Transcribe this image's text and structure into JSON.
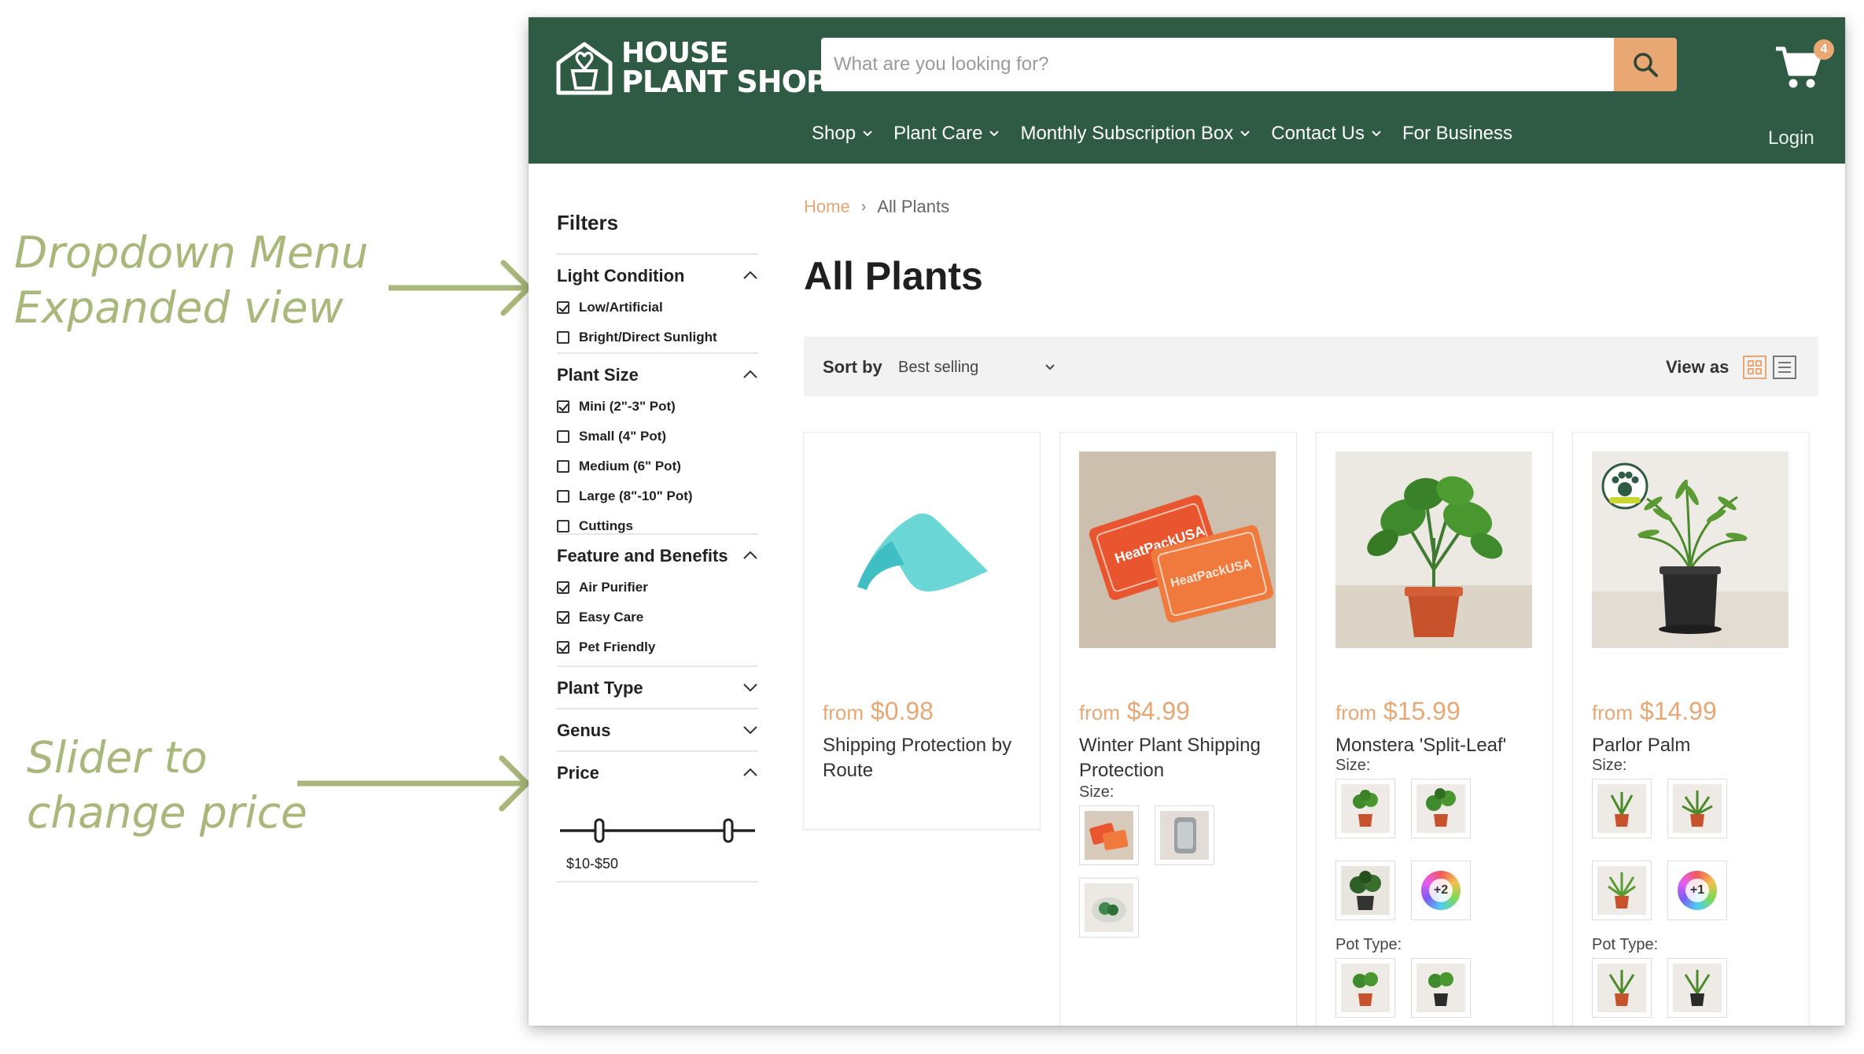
{
  "annotations": {
    "dropdown_line1": "Dropdown Menu",
    "dropdown_line2": "Expanded view",
    "slider_line1": "Slider to",
    "slider_line2": "change price"
  },
  "header": {
    "logo_line1": "HOUSE",
    "logo_line2": "PLANT SHOP",
    "search_placeholder": "What are you looking for?",
    "cart_count": "4",
    "login": "Login",
    "nav": [
      "Shop",
      "Plant Care",
      "Monthly Subscription Box",
      "Contact Us",
      "For Business"
    ]
  },
  "sidebar": {
    "title": "Filters",
    "sections": {
      "light": {
        "title": "Light Condition",
        "options": [
          {
            "label": "Low/Artificial",
            "checked": true
          },
          {
            "label": "Bright/Direct Sunlight",
            "checked": false
          }
        ]
      },
      "size": {
        "title": "Plant Size",
        "options": [
          {
            "label": "Mini (2\"-3\" Pot)",
            "checked": true
          },
          {
            "label": "Small (4\" Pot)",
            "checked": false
          },
          {
            "label": "Medium (6\" Pot)",
            "checked": false
          },
          {
            "label": "Large (8\"-10\" Pot)",
            "checked": false
          },
          {
            "label": "Cuttings",
            "checked": false
          }
        ]
      },
      "features": {
        "title": "Feature and Benefits",
        "options": [
          {
            "label": "Air Purifier",
            "checked": true
          },
          {
            "label": "Easy Care",
            "checked": true
          },
          {
            "label": "Pet Friendly",
            "checked": true
          }
        ]
      },
      "type": {
        "title": "Plant Type"
      },
      "genus": {
        "title": "Genus"
      },
      "price": {
        "title": "Price",
        "range": "$10-$50",
        "min": 10,
        "max": 50
      }
    }
  },
  "main": {
    "breadcrumb_home": "Home",
    "breadcrumb_current": "All Plants",
    "title": "All Plants",
    "sort_label": "Sort by",
    "sort_value": "Best selling",
    "view_label": "View as",
    "size_label": "Size:",
    "pot_type_label": "Pot Type:",
    "from": "from",
    "products": [
      {
        "price": "$0.98",
        "name": "Shipping Protection by Route"
      },
      {
        "price": "$4.99",
        "name": "Winter Plant Shipping Protection",
        "heatpack": "HeatPackUSA"
      },
      {
        "price": "$15.99",
        "name": "Monstera 'Split-Leaf'",
        "more": "+2"
      },
      {
        "price": "$14.99",
        "name": "Parlor Palm",
        "more": "+1"
      }
    ]
  },
  "colors": {
    "header_green": "#2f5a43",
    "accent_orange": "#e9a774",
    "annotation_green": "#a9b77a"
  }
}
